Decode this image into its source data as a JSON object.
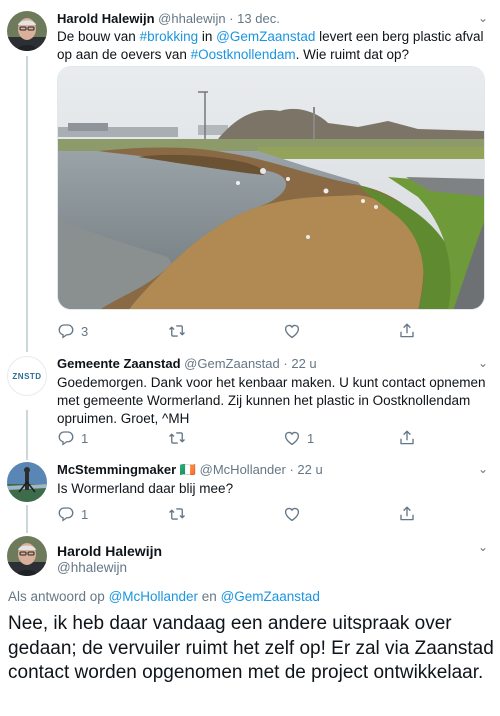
{
  "tweets": [
    {
      "name": "Harold Halewijn",
      "handle": "@hhalewijn",
      "separator": "·",
      "time": "13 dec.",
      "text_parts": [
        "De bouw van ",
        "#brokking",
        " in ",
        "@GemZaanstad",
        " levert een berg plastic afval op aan de oevers van ",
        "#Oostknollendam",
        ". Wie ruimt dat op?"
      ],
      "replies": "3",
      "retweets": "",
      "likes": ""
    },
    {
      "name": "Gemeente Zaanstad",
      "handle": "@GemZaanstad",
      "separator": "·",
      "time": "22 u",
      "avatar_text": "ZNSTD",
      "text": "Goedemorgen. Dank voor het kenbaar maken. U kunt contact opnemen met gemeente Wormerland. Zij kunnen het plastic in Oostknollendam opruimen. Groet, ^MH",
      "replies": "1",
      "retweets": "",
      "likes": "1"
    },
    {
      "name": "McStemmingmaker",
      "flag": "🇮🇪",
      "handle": "@McHollander",
      "separator": "·",
      "time": "22 u",
      "text": "Is Wormerland daar blij mee?",
      "replies": "1",
      "retweets": "",
      "likes": ""
    }
  ],
  "main": {
    "name": "Harold Halewijn",
    "handle": "@hhalewijn",
    "reply_prefix": "Als antwoord op ",
    "reply_user1": "@McHollander",
    "reply_and": " en ",
    "reply_user2": "@GemZaanstad",
    "text": "Nee, ik heb daar vandaag een andere uitspraak over gedaan; de vervuiler ruimt het zelf op! Er zal via Zaanstad contact worden opgenomen met de project ontwikkelaar."
  },
  "colors": {
    "link": "#1b95e0",
    "muted": "#657786",
    "thread_line": "#ccd6dd"
  },
  "icons": [
    "reply-icon",
    "retweet-icon",
    "like-icon",
    "share-icon",
    "chevron-down-icon"
  ]
}
